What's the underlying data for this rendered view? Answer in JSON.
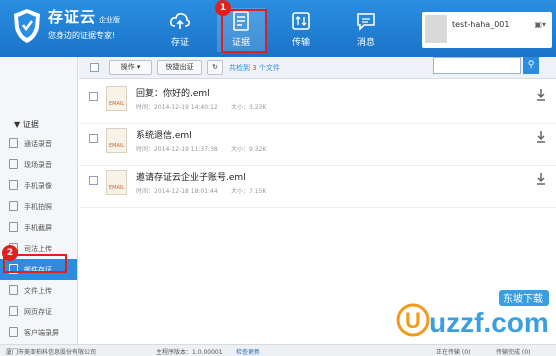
{
  "app": {
    "name": "存证云",
    "edition": "企业版",
    "slogan": "您身边的证据专家!"
  },
  "nav": [
    {
      "label": "存证",
      "icon": "cloud-upload-icon"
    },
    {
      "label": "证据",
      "icon": "evidence-document-icon"
    },
    {
      "label": "传输",
      "icon": "transfer-icon"
    },
    {
      "label": "消息",
      "icon": "message-icon"
    }
  ],
  "annotations": {
    "badge_1": "1",
    "badge_2": "2"
  },
  "user": {
    "name": "test-haha_001"
  },
  "sidebar": {
    "section": "▼ 证据",
    "items": [
      {
        "label": "通话录音"
      },
      {
        "label": "现场录音"
      },
      {
        "label": "手机录像"
      },
      {
        "label": "手机拍照"
      },
      {
        "label": "手机截屏"
      },
      {
        "label": "司法上传"
      },
      {
        "label": "邮件存证"
      },
      {
        "label": "文件上传"
      },
      {
        "label": "网页存证"
      },
      {
        "label": "客户端录屏"
      }
    ]
  },
  "toolbar": {
    "operate_label": "操作 ▾",
    "quick_label": "快捷出证",
    "refresh_icon": "↻",
    "count_text": "共检到 3 个文件",
    "search_placeholder": ""
  },
  "files": [
    {
      "name": "回复：你好的.eml",
      "time": "时间：2014-12-19 14:40:12",
      "size": "大小：3.23K"
    },
    {
      "name": "系统退信.eml",
      "time": "时间：2014-12-19 11:37:38",
      "size": "大小：9.32K"
    },
    {
      "name": "邀请存证云企业子账号.eml",
      "time": "时间：2014-12-18 18:01:44",
      "size": "大小：7.15K"
    }
  ],
  "file_tag": "EMAIL",
  "status": {
    "company": "厦门市美亚柏科信息股份有限公司",
    "version": "主程序版本：1.0.00001",
    "check_update": "检查更新",
    "transferring": "正在传输 (0)",
    "done": "传输完成 (0)"
  },
  "watermark": {
    "text": "uzzf.com",
    "sub": "东坡下载"
  },
  "colors": {
    "header": "#1f7fd2",
    "accent": "#2d8be0",
    "highlight": "#e0201c"
  }
}
